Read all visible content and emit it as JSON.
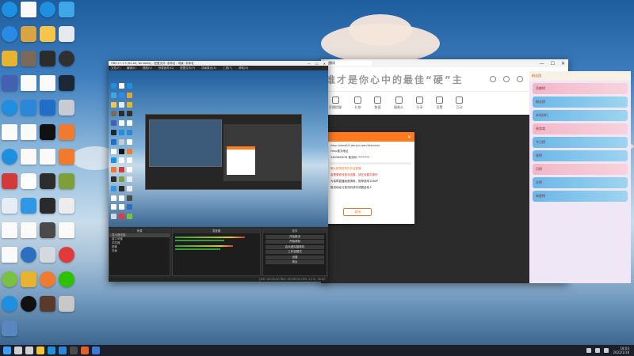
{
  "desktop": {
    "icons": [
      {
        "name": "edge-icon",
        "color": "#1f8fe0",
        "round": true
      },
      {
        "name": "file-icon",
        "file": true
      },
      {
        "name": "edge-icon",
        "color": "#1f8fe0",
        "round": true
      },
      {
        "name": "cloud-app-icon",
        "color": "#3fa7e8"
      },
      {
        "name": "edge-icon",
        "color": "#2a8be3",
        "round": true
      },
      {
        "name": "game-icon",
        "color": "#d9a441"
      },
      {
        "name": "sun-icon",
        "color": "#f7c54a"
      },
      {
        "name": "app-icon",
        "color": "#e6eaf0"
      },
      {
        "name": "owl-app-icon",
        "color": "#e7b431"
      },
      {
        "name": "game-icon",
        "color": "#7b6a5a"
      },
      {
        "name": "app-icon",
        "color": "#2c2c2c"
      },
      {
        "name": "obs-icon",
        "color": "#303030",
        "round": true
      },
      {
        "name": "app-icon",
        "color": "#4460b3"
      },
      {
        "name": "file-icon",
        "file": true
      },
      {
        "name": "file-icon",
        "file": true
      },
      {
        "name": "steam-icon",
        "color": "#1b2838"
      },
      {
        "name": "edge-icon",
        "color": "#1f8fe0",
        "round": true
      },
      {
        "name": "ie-icon",
        "color": "#2b88d8"
      },
      {
        "name": "app-icon",
        "color": "#1f6fc7"
      },
      {
        "name": "app-icon",
        "color": "#c7cbd3"
      },
      {
        "name": "file-icon",
        "file": true
      },
      {
        "name": "file-icon",
        "file": true
      },
      {
        "name": "app-icon",
        "color": "#111111"
      },
      {
        "name": "swift-icon",
        "color": "#f07b2e"
      },
      {
        "name": "edge-icon",
        "color": "#1f8fe0",
        "round": true
      },
      {
        "name": "file-icon",
        "file": true
      },
      {
        "name": "file-icon",
        "file": true
      },
      {
        "name": "swift-icon",
        "color": "#f07b2e"
      },
      {
        "name": "app-icon",
        "color": "#d33a3a"
      },
      {
        "name": "warning-icon",
        "color": "#ffffff"
      },
      {
        "name": "app-icon",
        "color": "#2d2d2d"
      },
      {
        "name": "tool-icon",
        "color": "#7da03a"
      },
      {
        "name": "app-icon",
        "color": "#e6edf4"
      },
      {
        "name": "cloud-app-icon",
        "color": "#3096e6"
      },
      {
        "name": "app-icon",
        "color": "#2a2a2a"
      },
      {
        "name": "app-icon",
        "color": "#ececec"
      },
      {
        "name": "file-icon",
        "file": true
      },
      {
        "name": "file-icon",
        "file": true
      },
      {
        "name": "app-icon",
        "color": "#4a4a4a"
      },
      {
        "name": "file-icon",
        "file": true
      },
      {
        "name": "file-icon",
        "file": true
      },
      {
        "name": "app-icon",
        "color": "#2c6fbf",
        "round": true
      },
      {
        "name": "app-icon",
        "color": "#d4d8df"
      },
      {
        "name": "netease-icon",
        "color": "#e03a3a",
        "round": true
      },
      {
        "name": "app-icon",
        "color": "#7bc043",
        "round": true
      },
      {
        "name": "app-icon",
        "color": "#e7b431"
      },
      {
        "name": "swift-icon",
        "color": "#f07b2e",
        "round": true
      },
      {
        "name": "wechat-icon",
        "color": "#2dc100",
        "round": true
      },
      {
        "name": "edge-icon",
        "color": "#1f8fe0",
        "round": true
      },
      {
        "name": "qq-icon",
        "color": "#111111",
        "round": true
      },
      {
        "name": "app-icon",
        "color": "#5a3a2a"
      },
      {
        "name": "app-icon",
        "color": "#c8c8c8"
      },
      {
        "name": "app-icon",
        "color": "#5a86c0"
      }
    ]
  },
  "obs": {
    "title": "OBS 27.1.3 (64-bit, windows) - 配置文件: 未命名 - 场景: 未命名",
    "minimize": "—",
    "maximize": "☐",
    "close": "✕",
    "menu": [
      "文件(F)",
      "编辑(E)",
      "视图(V)",
      "停靠部件(D)",
      "配置文件(P)",
      "场景集合(S)",
      "工具(T)",
      "帮助(H)"
    ],
    "scenes_title": "来源",
    "scenes": [
      "显示器采集",
      "窗口采集",
      "浏览器",
      "图像",
      "场景"
    ],
    "mixer_title": "混音器",
    "controls_title": "控件",
    "controls": [
      "开始推流",
      "开始录制",
      "启动虚拟摄像机",
      "工作室模式",
      "设置",
      "退出"
    ],
    "status": "LIVE: 00:00:00  REC: 00:00:00  CPU: 2.1%, 30.00 fps"
  },
  "browser": {
    "tab_label": "直播间",
    "logo_text": "谁才是你心中的最佳“硬”主",
    "nav": [
      {
        "icon": "alarm-icon",
        "label": "开播提醒"
      },
      {
        "icon": "gift-icon",
        "label": "礼物"
      },
      {
        "icon": "chart-icon",
        "label": "数据"
      },
      {
        "icon": "camera-icon",
        "label": "摄像头"
      },
      {
        "icon": "share-icon",
        "label": "分享"
      },
      {
        "icon": "setting-icon",
        "label": "设置"
      },
      {
        "icon": "game-icon",
        "label": "互动"
      }
    ],
    "live_button": "开始直播",
    "chat_header": "粉丝团",
    "chat_rows": [
      "贡献榜",
      "粉丝榜",
      "本场排行",
      "贵宾席",
      "今日榜",
      "周榜",
      "月榜",
      "总榜",
      "新星榜"
    ]
  },
  "dialog": {
    "lines": [
      "rtmp://send01.douyu.com/live/xxxx",
      "rtmp推流地址",
      "346389MO8 推流码: ********",
      "确认推流前请先开启直播",
      "若需要修改推流设置，请在设置中操作",
      "为保障直播画面清晰，推荐使用1080P",
      "推流地址与推流码请勿泄露给他人"
    ],
    "close_label": "✕",
    "ok_label": "关闭"
  },
  "taskbar": {
    "apps": [
      {
        "name": "start-icon",
        "color": "#3aa0ff"
      },
      {
        "name": "search-icon",
        "color": "#d0d0d0"
      },
      {
        "name": "taskview-icon",
        "color": "#d0d0d0"
      },
      {
        "name": "explorer-icon",
        "color": "#f3c33b"
      },
      {
        "name": "edge-icon",
        "color": "#1f8fe0"
      },
      {
        "name": "store-icon",
        "color": "#2b88d8"
      },
      {
        "name": "obs-icon",
        "color": "#4a4a4a"
      },
      {
        "name": "browser-icon",
        "color": "#e0612b"
      },
      {
        "name": "mail-icon",
        "color": "#3a7bd5"
      }
    ],
    "time": "18:03",
    "date": "2022/1/18"
  }
}
